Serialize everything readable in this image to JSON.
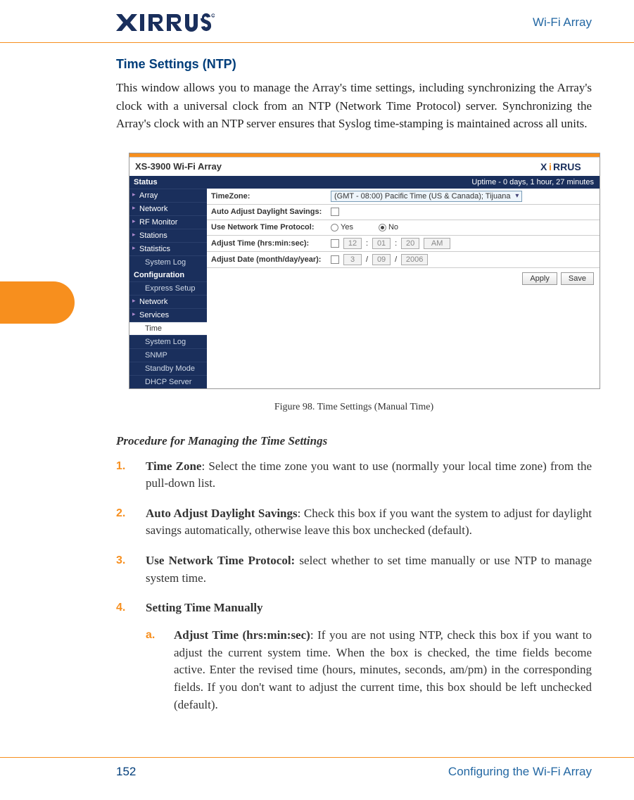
{
  "header": {
    "label": "Wi-Fi Array",
    "logo_alt": "XIRRUS"
  },
  "section": {
    "title": "Time Settings (NTP)",
    "intro": "This window allows you to manage the Array's time settings, including synchronizing the Array's clock with a universal clock from an NTP (Network Time Protocol) server. Synchronizing the Array's clock with an NTP server ensures that Syslog time-stamping is maintained across all units."
  },
  "figure": {
    "caption": "Figure 98. Time Settings (Manual Time)",
    "device_title": "XS-3900 Wi-Fi Array",
    "uptime": "Uptime - 0 days, 1 hour, 27 minutes",
    "nav": {
      "status": "Status",
      "items_status": [
        "Array",
        "Network",
        "RF Monitor",
        "Stations",
        "Statistics",
        "System Log"
      ],
      "config": "Configuration",
      "items_config": [
        "Express Setup",
        "Network",
        "Services"
      ],
      "items_services": [
        "Time",
        "System Log",
        "SNMP",
        "Standby Mode",
        "DHCP Server"
      ]
    },
    "form": {
      "timezone_label": "TimeZone:",
      "timezone_value": "(GMT - 08:00) Pacific Time (US & Canada); Tijuana",
      "daylight_label": "Auto Adjust Daylight Savings:",
      "ntp_label": "Use Network Time Protocol:",
      "ntp_yes": "Yes",
      "ntp_no": "No",
      "adjust_time_label": "Adjust Time (hrs:min:sec):",
      "adjust_time_h": "12",
      "adjust_time_m": "01",
      "adjust_time_s": "20",
      "adjust_time_ampm": "AM",
      "adjust_date_label": "Adjust Date (month/day/year):",
      "adjust_date_m": "3",
      "adjust_date_d": "09",
      "adjust_date_y": "2006",
      "apply": "Apply",
      "save": "Save"
    }
  },
  "procedure": {
    "title": "Procedure for Managing the Time Settings",
    "steps": [
      {
        "num": "1.",
        "bold": "Time Zone",
        "text": ": Select the time zone you want to use (normally your local time zone) from the pull-down list."
      },
      {
        "num": "2.",
        "bold": "Auto Adjust Daylight Savings",
        "text": ": Check this box if you want the system to adjust for daylight savings automatically, otherwise leave this box unchecked (default)."
      },
      {
        "num": "3.",
        "bold": "Use Network Time Protocol:",
        "text": " select whether to set time manually or use NTP to manage system time."
      },
      {
        "num": "4.",
        "bold": "Setting Time Manually",
        "text": ""
      }
    ],
    "substeps": [
      {
        "num": "a.",
        "bold": "Adjust Time (hrs:min:sec)",
        "text": ": If you are not using NTP, check this box if you want to adjust the current system time. When the box is checked, the time fields become active. Enter the revised time (hours, minutes, seconds, am/pm) in the corresponding fields. If you don't want to adjust the current time, this box should be left unchecked (default)."
      }
    ]
  },
  "footer": {
    "page": "152",
    "label": "Configuring the Wi-Fi Array"
  }
}
